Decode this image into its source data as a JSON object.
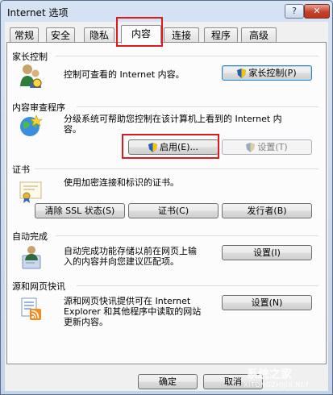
{
  "window": {
    "title": "Internet 选项",
    "help_label": "?",
    "close_label": "✕"
  },
  "tabs": [
    {
      "label": "常规"
    },
    {
      "label": "安全"
    },
    {
      "label": "隐私"
    },
    {
      "label": "内容"
    },
    {
      "label": "连接"
    },
    {
      "label": "程序"
    },
    {
      "label": "高级"
    }
  ],
  "active_tab": "内容",
  "parental": {
    "title": "家长控制",
    "desc": "控制可查看的 Internet 内容。",
    "button": "家长控制(P)"
  },
  "advisor": {
    "title": "内容审查程序",
    "desc_line1": "分级系统可帮助您控制在该计算机上看到的 Internet 内",
    "desc_line2": "容。",
    "enable_button": "启用(E)...",
    "settings_button": "设置(T)"
  },
  "certificates": {
    "title": "证书",
    "desc": "使用加密连接和标识的证书。",
    "clear_ssl_button": "清除 SSL 状态(S)",
    "certificates_button": "证书(C)",
    "publishers_button": "发行者(B)"
  },
  "autocomplete": {
    "title": "自动完成",
    "desc_line1": "自动完成功能存储以前在网页上输",
    "desc_line2": "入的内容并向您建议匹配项。",
    "settings_button": "设置(I)"
  },
  "feeds": {
    "title": "源和网页快讯",
    "desc_line1": "源和网页快讯提供可在 Internet",
    "desc_line2": "Explorer 和其他程序中读取的网站",
    "desc_line3": "更新内容。",
    "settings_button": "设置(N)"
  },
  "footer": {
    "ok_button": "确定",
    "cancel_button": "取消"
  },
  "watermark": {
    "line1": "系统之家",
    "line2": "XITONGZHIJIA.NET"
  },
  "colors": {
    "highlight_red": "#e0181f",
    "accent_blue": "#3c7fb1"
  }
}
